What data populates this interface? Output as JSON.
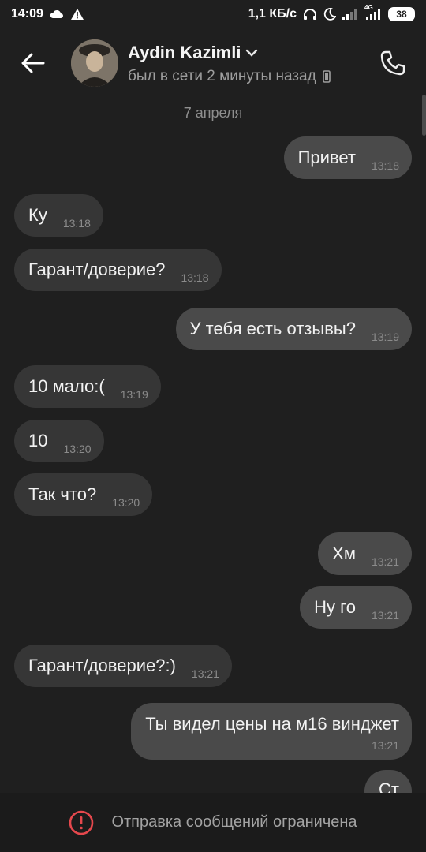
{
  "status_bar": {
    "time": "14:09",
    "net_speed": "1,1 КБ/с",
    "network": "4G",
    "battery": "38"
  },
  "header": {
    "contact_name": "Aydin Kazimli",
    "last_seen": "был в сети 2 минуты назад"
  },
  "chat": {
    "date_separator": "7 апреля",
    "messages": [
      {
        "direction": "out",
        "text": "Привет",
        "time": "13:18"
      },
      {
        "direction": "in",
        "text": "Ку",
        "time": "13:18"
      },
      {
        "direction": "in",
        "text": "Гарант/доверие?",
        "time": "13:18"
      },
      {
        "direction": "out",
        "text": "У тебя есть отзывы?",
        "time": "13:19"
      },
      {
        "direction": "in",
        "text": "10 мало:(",
        "time": "13:19"
      },
      {
        "direction": "in",
        "text": "10",
        "time": "13:20"
      },
      {
        "direction": "in",
        "text": "Так что?",
        "time": "13:20"
      },
      {
        "direction": "out",
        "text": "Хм",
        "time": "13:21"
      },
      {
        "direction": "out",
        "text": "Ну го",
        "time": "13:21"
      },
      {
        "direction": "in",
        "text": "Гарант/доверие?:)",
        "time": "13:21"
      },
      {
        "direction": "out",
        "text": "Ты видел цены на м16 винджет",
        "time": "13:21"
      },
      {
        "direction": "out",
        "text": "Ст",
        "time": ""
      }
    ]
  },
  "footer": {
    "notice": "Отправка сообщений ограничена"
  },
  "colors": {
    "background": "#1f1f1f",
    "incoming_bubble": "#363636",
    "outgoing_bubble": "#4a4a4a",
    "warning": "#e5484d"
  }
}
